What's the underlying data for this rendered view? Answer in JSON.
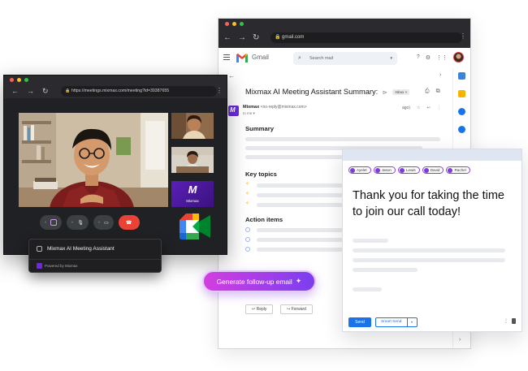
{
  "gmail": {
    "url": "gmail.com",
    "app_name": "Gmail",
    "search_placeholder": "Search mail",
    "subject": "Mixmax AI Meeting Assistant Summary:",
    "inbox_label": "Inbox ×",
    "sender_name": "Mixmax",
    "sender_email": "<no-reply@mixmax.com>",
    "to": "to me ▾",
    "time": "ago)",
    "sections": {
      "summary": "Summary",
      "key_topics": "Key topics",
      "action_items": "Action items"
    },
    "reply_label": "Reply",
    "forward_label": "Forward"
  },
  "meet": {
    "url": "https://meetings.mixmax.com/meeting?id=39387655",
    "tile_label": "Mixmax"
  },
  "assistant": {
    "title": "Mixmax AI Meeting Assistant",
    "footer": "Powered by Mixmax"
  },
  "generate_button": {
    "label": "Generate follow-up email"
  },
  "compose": {
    "recipients": [
      "Ayelet",
      "Jason",
      "Lewis",
      "David",
      "Rachel"
    ],
    "body": "Thank you for taking the time to join our call today!",
    "send_label": "Send",
    "smart_send_label": "Smart Send"
  },
  "colors": {
    "mixmax_purple": "#6b2bd9",
    "send_blue": "#1a73e8",
    "end_call_red": "#ea4335"
  }
}
